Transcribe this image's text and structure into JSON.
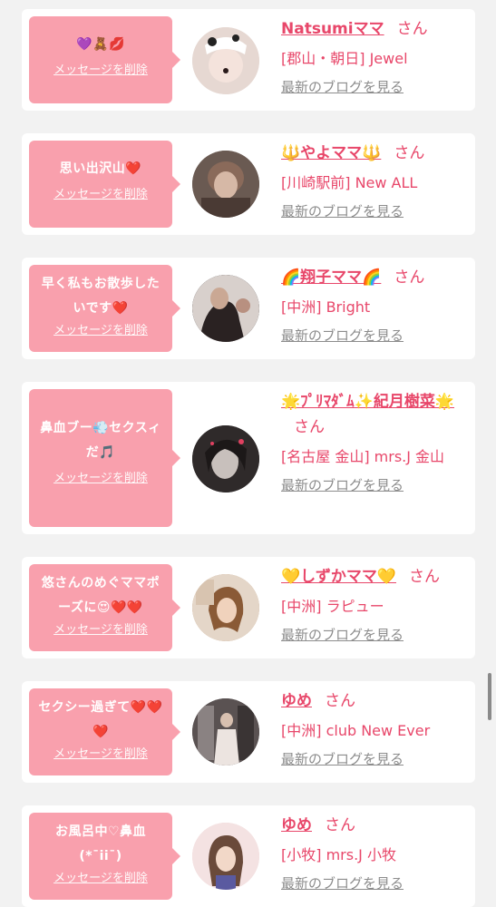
{
  "common": {
    "delete_label": "メッセージを削除",
    "blog_label": "最新のブログを見る",
    "san_suffix": "さん"
  },
  "cards": [
    {
      "message": "💜🧸💋",
      "name": "Natsumiママ",
      "shop": "[郡山・朝日] Jewel",
      "avatar_color": "#e6d8d2"
    },
    {
      "message": "思い出沢山❤️",
      "name": "🔱やよママ🔱",
      "shop": "[川崎駅前] New ALL",
      "avatar_color": "#6a5a52"
    },
    {
      "message": "早く私もお散歩したいです❤️",
      "name": "🌈翔子ママ🌈",
      "shop": "[中洲] Bright",
      "avatar_color": "#3c3434"
    },
    {
      "message": "鼻血ブー💨セクスィだ🎵",
      "name": "🌟ﾌﾟﾘﾏﾀﾞﾑ✨紀月樹菜🌟",
      "shop": "[名古屋 金山] mrs.J 金山",
      "avatar_color": "#2f2a2a"
    },
    {
      "message": "悠さんのめぐママポーズに😍❤️❤️",
      "name": "💛しずかママ💛",
      "shop": "[中洲] ラピュー",
      "avatar_color": "#c9a88a"
    },
    {
      "message": "セクシー過ぎて❤️❤️❤️",
      "name": "ゆめ",
      "shop": "[中洲] club New Ever",
      "avatar_color": "#4a4444"
    },
    {
      "message": "お風呂中♡鼻血(*¯ii¯)",
      "name": "ゆめ",
      "shop": "[小牧] mrs.J 小牧",
      "avatar_color": "#f0d6d6"
    }
  ],
  "colors": {
    "accent": "#e8476a",
    "bubble": "#f9a0ad",
    "background": "#f2f2f2",
    "link_gray": "#8c8c8c"
  }
}
